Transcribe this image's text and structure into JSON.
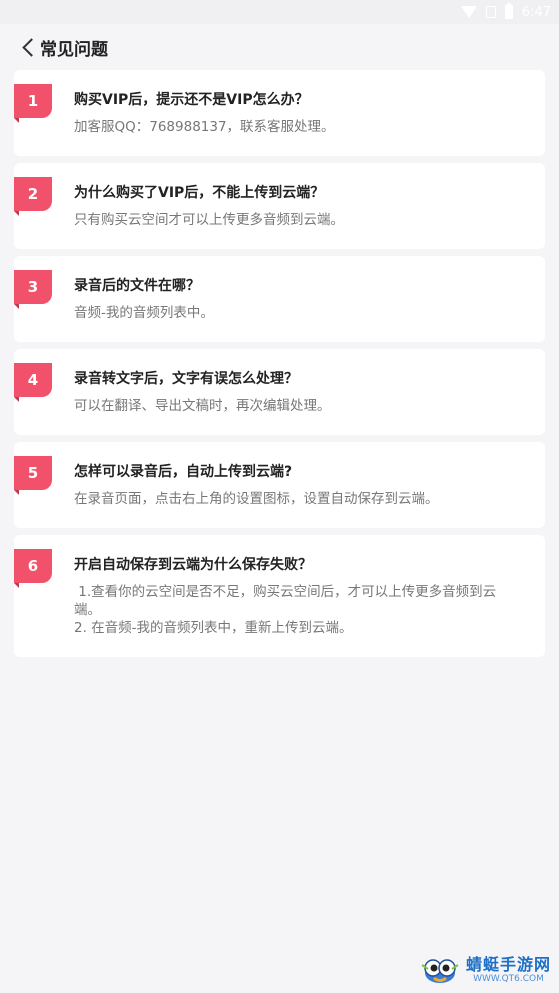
{
  "status_bar": {
    "time": "6:47",
    "wifi_icon": "wifi-icon",
    "sim_icon": "sim-icon",
    "battery_icon": "battery-icon"
  },
  "header": {
    "title": "常见问题",
    "back_icon": "chevron-left-icon"
  },
  "faqs": [
    {
      "number": "1",
      "question": "购买VIP后，提示还不是VIP怎么办？",
      "answer": "加客服QQ：768988137，联系客服处理。"
    },
    {
      "number": "2",
      "question": "为什么购买了VIP后，不能上传到云端？",
      "answer": "只有购买云空间才可以上传更多音频到云端。"
    },
    {
      "number": "3",
      "question": "录音后的文件在哪？",
      "answer": "音频-我的音频列表中。"
    },
    {
      "number": "4",
      "question": "录音转文字后，文字有误怎么处理？",
      "answer": "可以在翻译、导出文稿时，再次编辑处理。"
    },
    {
      "number": "5",
      "question": "怎样可以录音后，自动上传到云端?",
      "answer": "在录音页面，点击右上角的设置图标，设置自动保存到云端。"
    },
    {
      "number": "6",
      "question": "开启自动保存到云端为什么保存失败？",
      "answer": " 1.查看你的云空间是否不足，购买云空间后，才可以上传更多音频到云端。\n2. 在音频-我的音频列表中，重新上传到云端。"
    }
  ],
  "watermark": {
    "title": "蜻蜓手游网",
    "url": "WWW.QT6.COM",
    "logo_icon": "dragonfly-mascot-icon"
  },
  "colors": {
    "accent": "#f2516b",
    "background": "#f5f5f7",
    "card": "#ffffff"
  }
}
